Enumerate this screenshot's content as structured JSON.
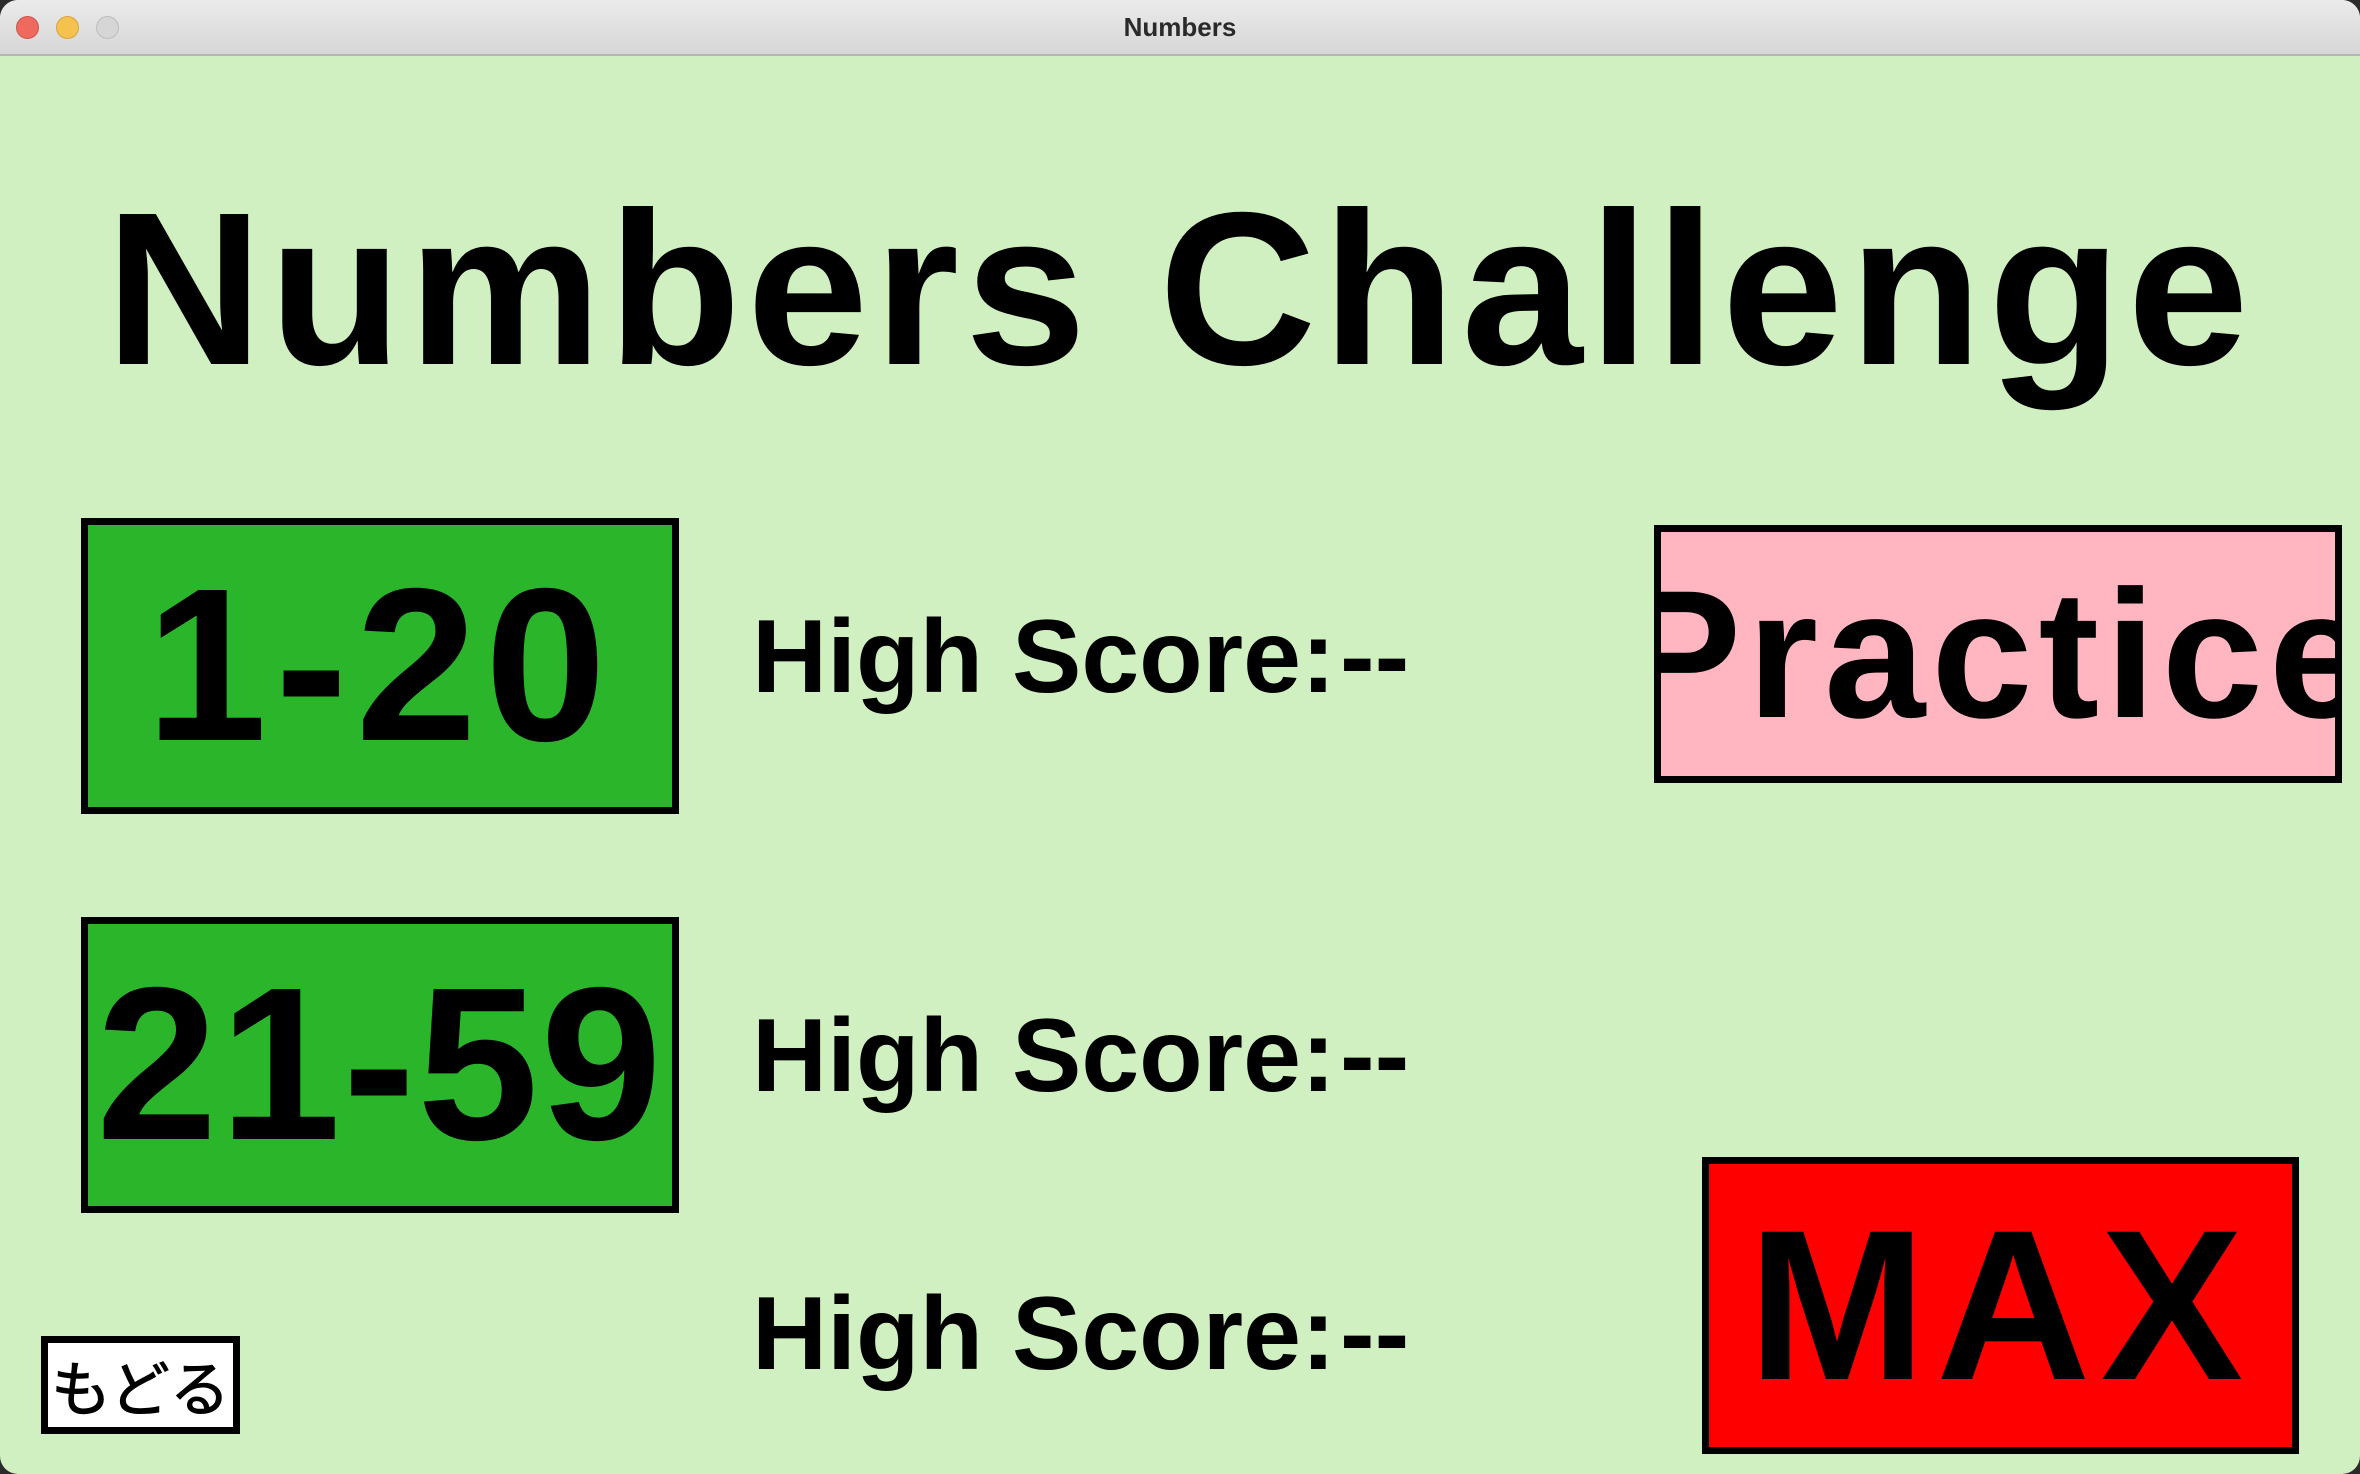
{
  "window": {
    "title": "Numbers"
  },
  "main": {
    "heading": "Numbers Challenge",
    "levels": [
      {
        "label": "1-20",
        "score_label": "High Score:",
        "score_value": "--"
      },
      {
        "label": "21-59",
        "score_label": "High Score:",
        "score_value": "--"
      },
      {
        "label": "MAX",
        "score_label": "High Score:",
        "score_value": "--"
      }
    ],
    "practice_label": "Practice",
    "back_label": "もどる"
  },
  "colors": {
    "background": "#d1f0c1",
    "level_button": "#2bb52b",
    "practice": "#ffb6c1",
    "max": "#ff0000"
  }
}
